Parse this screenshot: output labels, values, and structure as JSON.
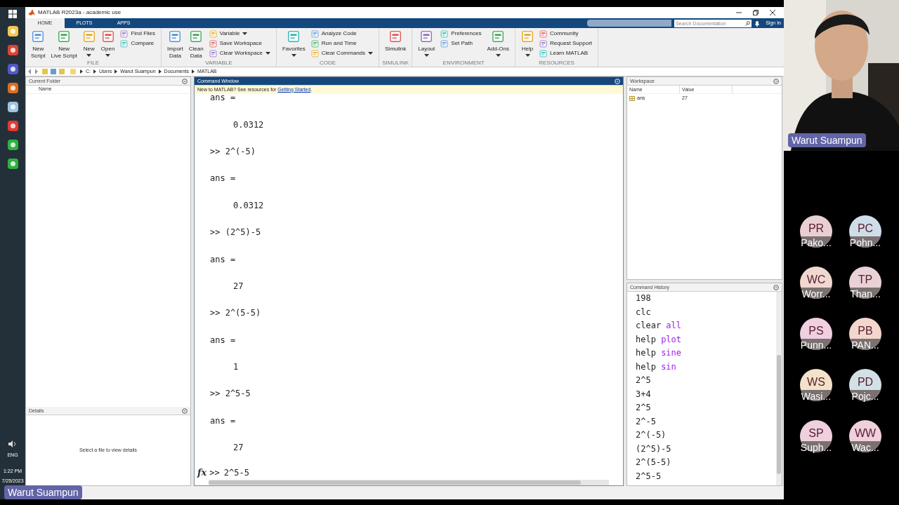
{
  "window": {
    "title": "MATLAB R2023a - academic use"
  },
  "tabs": [
    {
      "label": "HOME",
      "selected": true
    },
    {
      "label": "PLOTS",
      "selected": false
    },
    {
      "label": "APPS",
      "selected": false
    }
  ],
  "search": {
    "placeholder": "Search Documentation"
  },
  "sign_in": "Sign In",
  "ribbon": [
    {
      "label": "FILE",
      "items": [
        {
          "kind": "large",
          "lines": [
            "New",
            "Script"
          ],
          "dropdown": false
        },
        {
          "kind": "large",
          "lines": [
            "New",
            "Live Script"
          ],
          "dropdown": false
        },
        {
          "kind": "large",
          "lines": [
            "New"
          ],
          "dropdown": true
        },
        {
          "kind": "large",
          "lines": [
            "Open"
          ],
          "dropdown": true
        },
        {
          "kind": "small",
          "lines": [
            "Find Files"
          ],
          "dropdown": false
        },
        {
          "kind": "small",
          "lines": [
            "Compare"
          ],
          "dropdown": false
        }
      ]
    },
    {
      "label": "VARIABLE",
      "items": [
        {
          "kind": "large",
          "lines": [
            "Import",
            "Data"
          ],
          "dropdown": false
        },
        {
          "kind": "large",
          "lines": [
            "Clean",
            "Data"
          ],
          "dropdown": false
        },
        {
          "kind": "small",
          "lines": [
            "Variable"
          ],
          "dropdown": true
        },
        {
          "kind": "small",
          "lines": [
            "Save Workspace"
          ],
          "dropdown": false
        },
        {
          "kind": "small",
          "lines": [
            "Clear Workspace"
          ],
          "dropdown": true
        }
      ]
    },
    {
      "label": "CODE",
      "items": [
        {
          "kind": "large",
          "lines": [
            "Favorites"
          ],
          "dropdown": true
        },
        {
          "kind": "small",
          "lines": [
            "Analyze Code"
          ],
          "dropdown": false
        },
        {
          "kind": "small",
          "lines": [
            "Run and Time"
          ],
          "dropdown": false
        },
        {
          "kind": "small",
          "lines": [
            "Clear Commands"
          ],
          "dropdown": true
        }
      ]
    },
    {
      "label": "SIMULINK",
      "items": [
        {
          "kind": "large",
          "lines": [
            "Simulink"
          ],
          "dropdown": false
        }
      ]
    },
    {
      "label": "ENVIRONMENT",
      "items": [
        {
          "kind": "large",
          "lines": [
            "Layout"
          ],
          "dropdown": true
        },
        {
          "kind": "small",
          "lines": [
            "Preferences"
          ],
          "dropdown": false
        },
        {
          "kind": "small",
          "lines": [
            "Set Path"
          ],
          "dropdown": false
        },
        {
          "kind": "large",
          "lines": [
            "Add-Ons"
          ],
          "dropdown": true
        }
      ]
    },
    {
      "label": "RESOURCES",
      "items": [
        {
          "kind": "large",
          "lines": [
            "Help"
          ],
          "dropdown": true
        },
        {
          "kind": "small",
          "lines": [
            "Community"
          ],
          "dropdown": false
        },
        {
          "kind": "small",
          "lines": [
            "Request Support"
          ],
          "dropdown": false
        },
        {
          "kind": "small",
          "lines": [
            "Learn MATLAB"
          ],
          "dropdown": false
        }
      ]
    }
  ],
  "address": [
    "C:",
    "Users",
    "Warut Suampun",
    "Documents",
    "MATLAB"
  ],
  "current_folder": {
    "title": "Current Folder",
    "column": "Name"
  },
  "details": {
    "title": "Details",
    "message": "Select a file to view details"
  },
  "command_window": {
    "title": "Command Window",
    "banner": "New to MATLAB? See resources for ",
    "banner_link": "Getting Started",
    "banner_end": ".",
    "lines": [
      {
        "kind": "output",
        "text": "ans ="
      },
      {
        "kind": "value",
        "text": "0.0312"
      },
      {
        "kind": "prompt",
        "text": ">> 2^(-5)"
      },
      {
        "kind": "output",
        "text": "ans ="
      },
      {
        "kind": "value",
        "text": "0.0312"
      },
      {
        "kind": "prompt",
        "text": ">> (2^5)-5"
      },
      {
        "kind": "output",
        "text": "ans ="
      },
      {
        "kind": "value",
        "text": "27"
      },
      {
        "kind": "prompt",
        "text": ">> 2^(5-5)"
      },
      {
        "kind": "output",
        "text": "ans ="
      },
      {
        "kind": "value",
        "text": "1"
      },
      {
        "kind": "prompt",
        "text": ">> 2^5-5"
      },
      {
        "kind": "output",
        "text": "ans ="
      },
      {
        "kind": "value",
        "text": "27"
      }
    ],
    "fx": "fx",
    "prompt": ">>",
    "input": "2^5-5"
  },
  "workspace": {
    "title": "Workspace",
    "columns": [
      "Name",
      "Value"
    ],
    "rows": [
      {
        "name": "ans",
        "value": "27"
      }
    ]
  },
  "history": {
    "title": "Command History",
    "items": [
      {
        "command": "198"
      },
      {
        "command": "clc"
      },
      {
        "command": "clear",
        "arg": "all"
      },
      {
        "command": "help",
        "arg": "plot"
      },
      {
        "command": "help",
        "arg": "sine"
      },
      {
        "command": "help",
        "arg": "sin"
      },
      {
        "command": "2^5"
      },
      {
        "command": "3+4"
      },
      {
        "command": "2^5"
      },
      {
        "command": "2^-5"
      },
      {
        "command": "2^(-5)"
      },
      {
        "command": "(2^5)-5"
      },
      {
        "command": "2^(5-5)"
      },
      {
        "command": "2^5-5"
      }
    ]
  },
  "taskbar": {
    "language": "ENG",
    "time": "1:22 PM",
    "date": "7/25/2023"
  },
  "call": {
    "speaker": "Warut Suampun",
    "caption": "Warut Suampun",
    "participants": [
      {
        "initials": "PR",
        "name": "Pako...",
        "color": "#e9cfd2"
      },
      {
        "initials": "PC",
        "name": "Pohn...",
        "color": "#cfdde9"
      },
      {
        "initials": "WC",
        "name": "Worr...",
        "color": "#f0d8d0"
      },
      {
        "initials": "TP",
        "name": "Than...",
        "color": "#e9d2d6"
      },
      {
        "initials": "PS",
        "name": "Punn...",
        "color": "#efcfe0"
      },
      {
        "initials": "PB",
        "name": "PAN...",
        "color": "#f3d6cc"
      },
      {
        "initials": "WS",
        "name": "Wasi...",
        "color": "#f3e2c9"
      },
      {
        "initials": "PD",
        "name": "Pojc...",
        "color": "#d3e1e6"
      },
      {
        "initials": "SP",
        "name": "Suph...",
        "color": "#efd0de"
      },
      {
        "initials": "WW",
        "name": "Wac...",
        "color": "#efd0dc"
      }
    ]
  }
}
